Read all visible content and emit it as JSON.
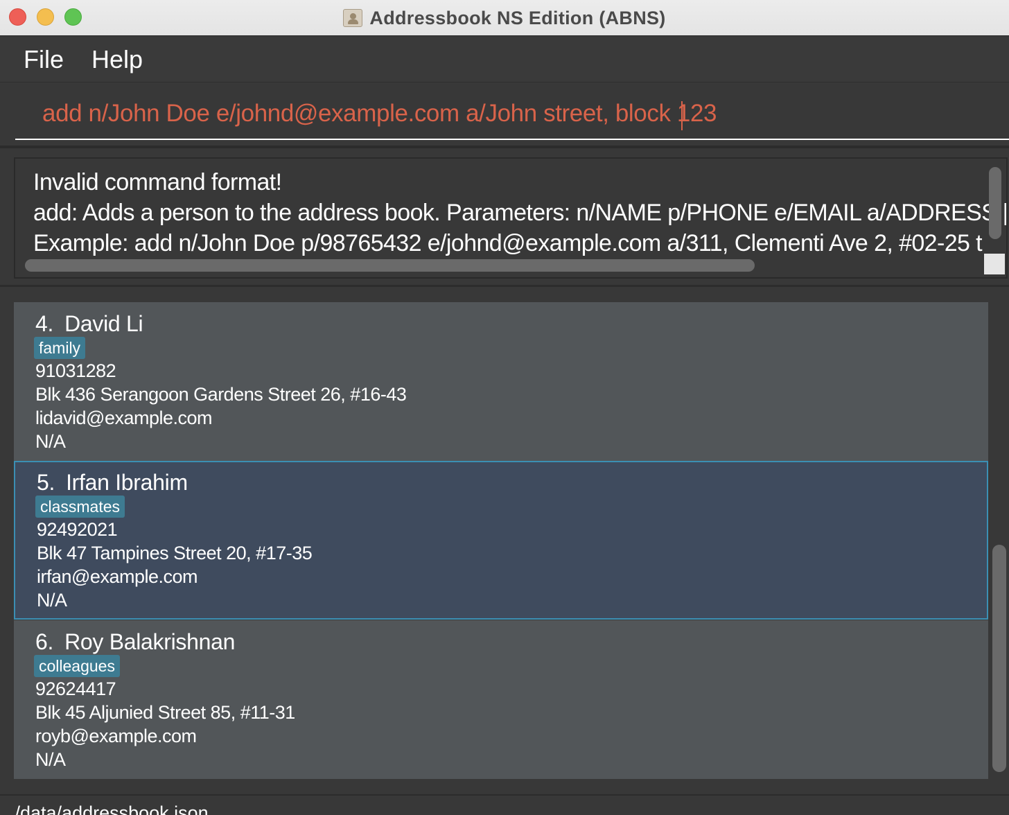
{
  "window": {
    "title": "Addressbook NS Edition (ABNS)",
    "app_icon": "address-book-icon"
  },
  "menu": {
    "items": [
      {
        "label": "File"
      },
      {
        "label": "Help"
      }
    ]
  },
  "command": {
    "value": "add n/John Doe e/johnd@example.com a/John street, block 123",
    "text_color": "#d9634a"
  },
  "result": {
    "lines": [
      "Invalid command format!",
      "add: Adds a person to the address book. Parameters: n/NAME p/PHONE e/EMAIL a/ADDRESS [",
      "Example: add n/John Doe p/98765432 e/johnd@example.com a/311, Clementi Ave 2, #02-25 t"
    ]
  },
  "persons": [
    {
      "index": "4.",
      "name": "David Li",
      "tag": "family",
      "phone": "91031282",
      "address": "Blk 436 Serangoon Gardens Street 26, #16-43",
      "email": "lidavid@example.com",
      "extra": "N/A",
      "selected": false
    },
    {
      "index": "5.",
      "name": "Irfan Ibrahim",
      "tag": "classmates",
      "phone": "92492021",
      "address": "Blk 47 Tampines Street 20, #17-35",
      "email": "irfan@example.com",
      "extra": "N/A",
      "selected": true
    },
    {
      "index": "6.",
      "name": "Roy Balakrishnan",
      "tag": "colleagues",
      "phone": "92624417",
      "address": "Blk 45 Aljunied Street 85, #11-31",
      "email": "royb@example.com",
      "extra": "N/A",
      "selected": false
    }
  ],
  "status": {
    "path": "./data/addressbook.json"
  },
  "colors": {
    "card_bg": "#525659",
    "selected_card_bg": "#3f4b5e",
    "selected_border": "#3b8fb3",
    "tag_bg": "#3e7b91"
  }
}
